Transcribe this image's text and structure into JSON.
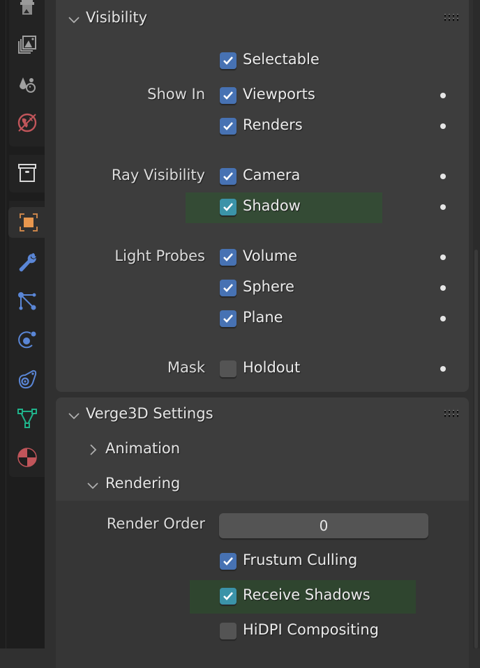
{
  "sidebar": {
    "tabs": [
      {
        "name": "output-tab",
        "icon": "printer-icon",
        "color": "#9a9a9a"
      },
      {
        "name": "view-layer-tab",
        "icon": "images-icon",
        "color": "#a0a0a0"
      },
      {
        "name": "scene-tab",
        "icon": "scene-icon",
        "color": "#a0a0a0"
      },
      {
        "name": "world-tab",
        "icon": "world-icon",
        "color": "#c0555a"
      },
      {
        "name": "collection-tab",
        "icon": "collection-box-icon",
        "color": "#d8d8d8"
      },
      {
        "name": "object-tab",
        "icon": "object-icon",
        "color": "#e8974e",
        "active": true
      },
      {
        "name": "modifiers-tab",
        "icon": "wrench-icon",
        "color": "#5a86d6"
      },
      {
        "name": "particles-tab",
        "icon": "particles-icon",
        "color": "#5a86d6"
      },
      {
        "name": "physics-tab",
        "icon": "physics-icon",
        "color": "#5a86d6"
      },
      {
        "name": "constraints-tab",
        "icon": "constraint-icon",
        "color": "#5a86d6"
      },
      {
        "name": "data-tab",
        "icon": "mesh-data-icon",
        "color": "#20b28a"
      },
      {
        "name": "material-tab",
        "icon": "material-icon",
        "color": "#c0555a"
      }
    ]
  },
  "visibility": {
    "title": "Visibility",
    "selectable": {
      "label": "Selectable",
      "checked": true
    },
    "show_in": {
      "label": "Show In",
      "viewports": {
        "label": "Viewports",
        "checked": true
      },
      "renders": {
        "label": "Renders",
        "checked": true
      }
    },
    "ray_visibility": {
      "label": "Ray Visibility",
      "camera": {
        "label": "Camera",
        "checked": true
      },
      "shadow": {
        "label": "Shadow",
        "checked": true,
        "highlighted": true
      }
    },
    "light_probes": {
      "label": "Light Probes",
      "volume": {
        "label": "Volume",
        "checked": true
      },
      "sphere": {
        "label": "Sphere",
        "checked": true
      },
      "plane": {
        "label": "Plane",
        "checked": true
      }
    },
    "mask": {
      "label": "Mask",
      "holdout": {
        "label": "Holdout",
        "checked": false
      }
    }
  },
  "verge3d": {
    "title": "Verge3D Settings",
    "animation": {
      "label": "Animation",
      "expanded": false
    },
    "rendering": {
      "label": "Rendering",
      "expanded": true,
      "render_order": {
        "label": "Render Order",
        "value": "0"
      },
      "frustum_culling": {
        "label": "Frustum Culling",
        "checked": true
      },
      "receive_shadows": {
        "label": "Receive Shadows",
        "checked": true,
        "highlighted": true
      },
      "hidpi_compositing": {
        "label": "HiDPI Compositing",
        "checked": false
      }
    }
  }
}
